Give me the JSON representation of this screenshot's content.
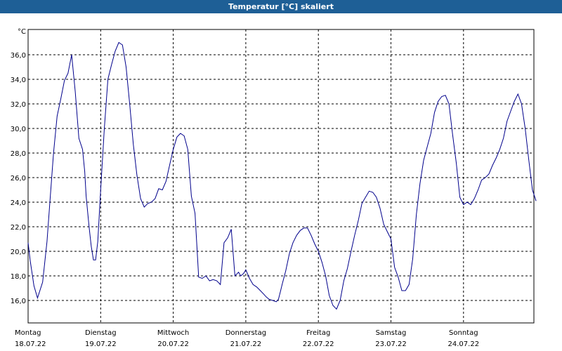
{
  "window": {
    "title": "Temperatur [°C] skaliert"
  },
  "chart_data": {
    "type": "line",
    "title": "Temperatur [°C] skaliert",
    "unit": "°C",
    "xlabel": "",
    "ylabel": "",
    "ylim": [
      15,
      38.5
    ],
    "xlim": [
      0,
      7
    ],
    "grid": true,
    "line_color": "#00008b",
    "y_ticks": [
      16.0,
      18.0,
      20.0,
      22.0,
      24.0,
      26.0,
      28.0,
      30.0,
      32.0,
      34.0,
      36.0
    ],
    "y_tick_labels": [
      "16,0",
      "18,0",
      "20,0",
      "22,0",
      "24,0",
      "26,0",
      "28,0",
      "30,0",
      "32,0",
      "34,0",
      "36,0"
    ],
    "x_ticks": [
      {
        "day": "Montag",
        "date": "18.07.22"
      },
      {
        "day": "Dienstag",
        "date": "19.07.22"
      },
      {
        "day": "Mittwoch",
        "date": "20.07.22"
      },
      {
        "day": "Donnerstag",
        "date": "21.07.22"
      },
      {
        "day": "Freitag",
        "date": "22.07.22"
      },
      {
        "day": "Samstag",
        "date": "23.07.22"
      },
      {
        "day": "Sonntag",
        "date": "24.07.22"
      }
    ],
    "series": [
      {
        "x": [
          0.0,
          0.03,
          0.08,
          0.13,
          0.2,
          0.26,
          0.3,
          0.35,
          0.4,
          0.45,
          0.5,
          0.55,
          0.6,
          0.65,
          0.7,
          0.75,
          0.78,
          0.8,
          0.84,
          0.87,
          0.9,
          0.93,
          0.96,
          1.0,
          1.05,
          1.1,
          1.15,
          1.2,
          1.25,
          1.3,
          1.35,
          1.4,
          1.45,
          1.5,
          1.55,
          1.6,
          1.65,
          1.7,
          1.75,
          1.8,
          1.85,
          1.9,
          1.95,
          2.0,
          2.05,
          2.1,
          2.15,
          2.2,
          2.25,
          2.3,
          2.35,
          2.4,
          2.45,
          2.5,
          2.55,
          2.6,
          2.65,
          2.7,
          2.75,
          2.8,
          2.85,
          2.9,
          2.93,
          2.97,
          3.0,
          3.05,
          3.1,
          3.15,
          3.2,
          3.25,
          3.28,
          3.32,
          3.37,
          3.42,
          3.45,
          3.48,
          3.5,
          3.55,
          3.6,
          3.65,
          3.7,
          3.75,
          3.8,
          3.85,
          3.9,
          3.95,
          4.0,
          4.05,
          4.1,
          4.15,
          4.2,
          4.25,
          4.3,
          4.35,
          4.4,
          4.45,
          4.5,
          4.55,
          4.6,
          4.65,
          4.7,
          4.75,
          4.8,
          4.85,
          4.9,
          4.95,
          5.0,
          5.05,
          5.1,
          5.15,
          5.2,
          5.25,
          5.3,
          5.35,
          5.4,
          5.45,
          5.5,
          5.55,
          5.6,
          5.65,
          5.7,
          5.75,
          5.8,
          5.85,
          5.9,
          5.95,
          6.0,
          6.05,
          6.1,
          6.15,
          6.2,
          6.25,
          6.3,
          6.35,
          6.4,
          6.45,
          6.5,
          6.55,
          6.6,
          6.65,
          6.7,
          6.75,
          6.8,
          6.85,
          6.9,
          6.95,
          7.0
        ],
        "values": [
          20.7,
          19.2,
          17.2,
          16.2,
          17.5,
          20.8,
          24.0,
          28.0,
          31.0,
          32.4,
          33.9,
          34.5,
          36.0,
          33.0,
          29.2,
          28.3,
          26.5,
          24.5,
          22.0,
          20.4,
          19.3,
          19.3,
          20.8,
          25.0,
          30.0,
          34.0,
          35.2,
          36.3,
          37.0,
          36.8,
          35.0,
          32.0,
          28.7,
          26.2,
          24.3,
          23.6,
          23.9,
          24.0,
          24.3,
          25.1,
          25.0,
          25.7,
          27.0,
          28.3,
          29.3,
          29.6,
          29.4,
          28.3,
          24.5,
          23.1,
          17.9,
          17.8,
          18.0,
          17.6,
          17.7,
          17.6,
          17.3,
          20.7,
          21.1,
          21.8,
          18.0,
          18.3,
          18.0,
          18.2,
          18.5,
          17.8,
          17.3,
          17.1,
          16.8,
          16.5,
          16.3,
          16.1,
          16.0,
          15.9,
          16.1,
          16.8,
          17.3,
          18.4,
          19.8,
          20.7,
          21.3,
          21.7,
          21.9,
          21.9,
          21.3,
          20.6,
          20.0,
          19.1,
          18.0,
          16.4,
          15.6,
          15.3,
          16.0,
          17.6,
          18.6,
          20.0,
          21.3,
          22.5,
          23.9,
          24.4,
          24.9,
          24.8,
          24.4,
          23.5,
          22.2,
          21.6,
          21.0,
          18.7,
          17.9,
          16.8,
          16.8,
          17.3,
          19.4,
          23.0,
          25.5,
          27.4,
          28.5,
          29.6,
          31.3,
          32.2,
          32.6,
          32.7,
          32.0,
          29.5,
          27.2,
          24.4,
          23.8,
          24.0,
          23.8,
          24.3,
          25.0,
          25.8,
          26.0,
          26.3,
          27.0,
          27.6,
          28.3,
          29.2,
          30.6,
          31.4,
          32.2,
          32.8,
          32.0,
          30.0,
          27.4,
          25.0,
          24.1
        ]
      }
    ]
  }
}
